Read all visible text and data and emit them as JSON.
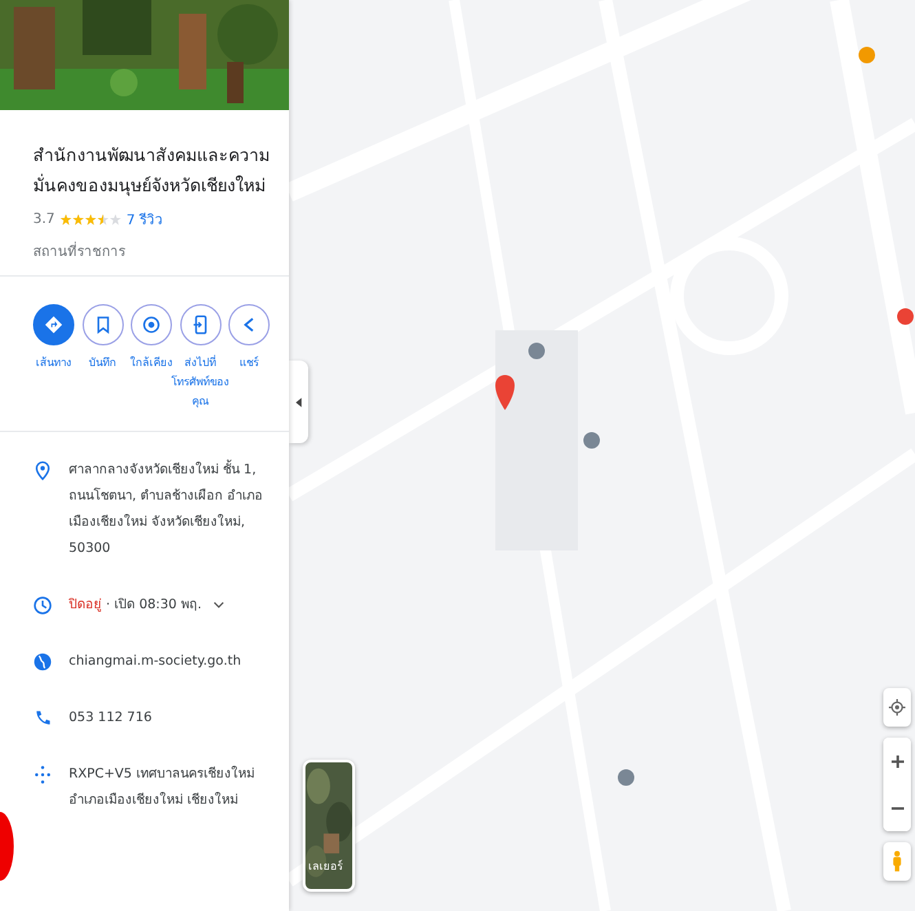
{
  "place": {
    "title": "สำนักงานพัฒนาสังคมและความมั่นคงของมนุษย์จังหวัดเชียงใหม่",
    "rating": "3.7",
    "stars": 3.5,
    "reviews": "7 รีวิว",
    "category": "สถานที่ราชการ"
  },
  "actions": [
    {
      "kind": "directions",
      "label": "เส้นทาง",
      "primary": true
    },
    {
      "kind": "save",
      "label": "บันทึก",
      "primary": false
    },
    {
      "kind": "nearby",
      "label": "ใกล้เคียง",
      "primary": false
    },
    {
      "kind": "phone",
      "label": "ส่งไปที่โทรศัพท์ของคุณ",
      "primary": false
    },
    {
      "kind": "share",
      "label": "แชร์",
      "primary": false
    }
  ],
  "info": [
    {
      "kind": "address",
      "text": "ศาลากลางจังหวัดเชียงใหม่ ชั้น 1, ถนนโชตนา, ตำบลช้างเผือก อำเภอเมืองเชียงใหม่ จังหวัดเชียงใหม่, 50300"
    },
    {
      "kind": "hours",
      "status": "ปิดอยู่",
      "text": " · เปิด 08:30 พฤ."
    },
    {
      "kind": "website",
      "text": "chiangmai.m-society.go.th"
    },
    {
      "kind": "phone",
      "text": "053 112 716"
    },
    {
      "kind": "pluscode",
      "text": "RXPC+V5 เทศบาลนครเชียงใหม่ อำเภอเมืองเชียงใหม่ เชียงใหม่"
    }
  ],
  "map": {
    "layers_label": "เลเยอร์"
  }
}
